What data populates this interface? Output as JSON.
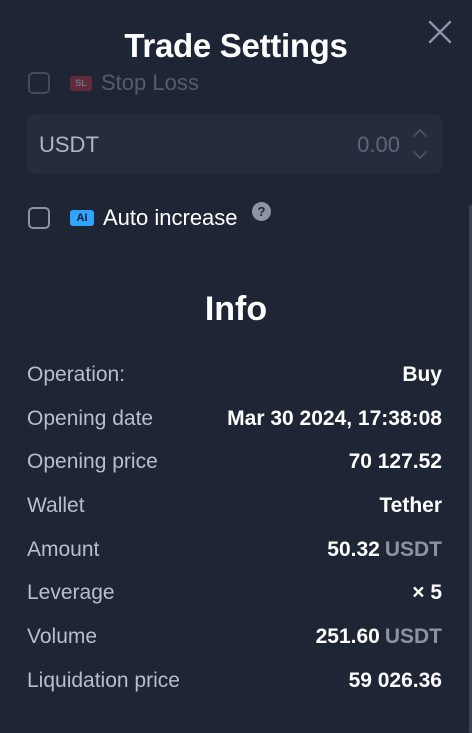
{
  "header": {
    "title": "Trade Settings",
    "close_icon": "close-icon"
  },
  "stop_loss": {
    "badge": "SL",
    "label": "Stop Loss",
    "checked": false
  },
  "amount_input": {
    "currency": "USDT",
    "value": "0.00",
    "stepper_icon": "up-down-chevron-icon"
  },
  "auto_increase": {
    "badge": "AI",
    "label": "Auto increase",
    "help": "?",
    "checked": false
  },
  "info": {
    "heading": "Info",
    "rows": [
      {
        "label": "Operation:",
        "value": "Buy",
        "unit": ""
      },
      {
        "label": "Opening date",
        "value": "Mar 30 2024, 17:38:08",
        "unit": ""
      },
      {
        "label": "Opening price",
        "value": "70 127.52",
        "unit": ""
      },
      {
        "label": "Wallet",
        "value": "Tether",
        "unit": ""
      },
      {
        "label": "Amount",
        "value": "50.32",
        "unit": "USDT"
      },
      {
        "label": "Leverage",
        "value": "× 5",
        "unit": ""
      },
      {
        "label": "Volume",
        "value": "251.60",
        "unit": "USDT"
      },
      {
        "label": "Liquidation price",
        "value": "59 026.36",
        "unit": ""
      }
    ]
  },
  "colors": {
    "background": "#1e2535",
    "input_background": "#252c3d",
    "sl_badge": "#e2364c",
    "ai_badge": "#2ea6ff",
    "label_text": "#b7bfcf",
    "unit_text": "#8a93a6"
  }
}
